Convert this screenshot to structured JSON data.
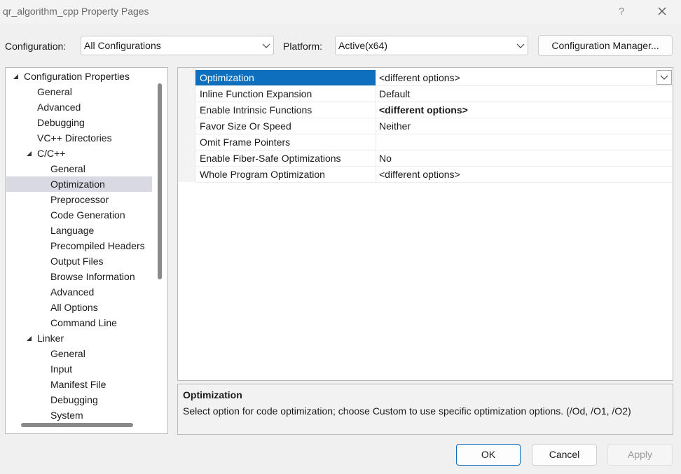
{
  "window": {
    "title": "qr_algorithm_cpp Property Pages",
    "help": "?",
    "close_icon": "close-icon"
  },
  "toolbar": {
    "configuration_label": "Configuration:",
    "configuration_value": "All Configurations",
    "platform_label": "Platform:",
    "platform_value": "Active(x64)",
    "config_manager_label": "Configuration Manager..."
  },
  "tree": {
    "selected": "Optimization",
    "items": [
      {
        "label": "Configuration Properties",
        "expanded": true
      },
      {
        "label": "General"
      },
      {
        "label": "Advanced"
      },
      {
        "label": "Debugging"
      },
      {
        "label": "VC++ Directories"
      },
      {
        "label": "C/C++",
        "expanded": true
      },
      {
        "label": "General"
      },
      {
        "label": "Optimization"
      },
      {
        "label": "Preprocessor"
      },
      {
        "label": "Code Generation"
      },
      {
        "label": "Language"
      },
      {
        "label": "Precompiled Headers"
      },
      {
        "label": "Output Files"
      },
      {
        "label": "Browse Information"
      },
      {
        "label": "Advanced"
      },
      {
        "label": "All Options"
      },
      {
        "label": "Command Line"
      },
      {
        "label": "Linker",
        "expanded": true
      },
      {
        "label": "General"
      },
      {
        "label": "Input"
      },
      {
        "label": "Manifest File"
      },
      {
        "label": "Debugging"
      },
      {
        "label": "System"
      }
    ]
  },
  "properties": [
    {
      "name": "Optimization",
      "value": "<different options>",
      "selected": true
    },
    {
      "name": "Inline Function Expansion",
      "value": "Default"
    },
    {
      "name": "Enable Intrinsic Functions",
      "value": "<different options>",
      "bold": true
    },
    {
      "name": "Favor Size Or Speed",
      "value": "Neither"
    },
    {
      "name": "Omit Frame Pointers",
      "value": ""
    },
    {
      "name": "Enable Fiber-Safe Optimizations",
      "value": "No"
    },
    {
      "name": "Whole Program Optimization",
      "value": "<different options>"
    }
  ],
  "description": {
    "title": "Optimization",
    "text": "Select option for code optimization; choose Custom to use specific optimization options.     (/Od, /O1, /O2)"
  },
  "buttons": {
    "ok": "OK",
    "cancel": "Cancel",
    "apply": "Apply"
  },
  "colors": {
    "selection": "#0d6fbe",
    "tree_selection": "#d9d9e4",
    "ok_border": "#0f6cbd"
  }
}
